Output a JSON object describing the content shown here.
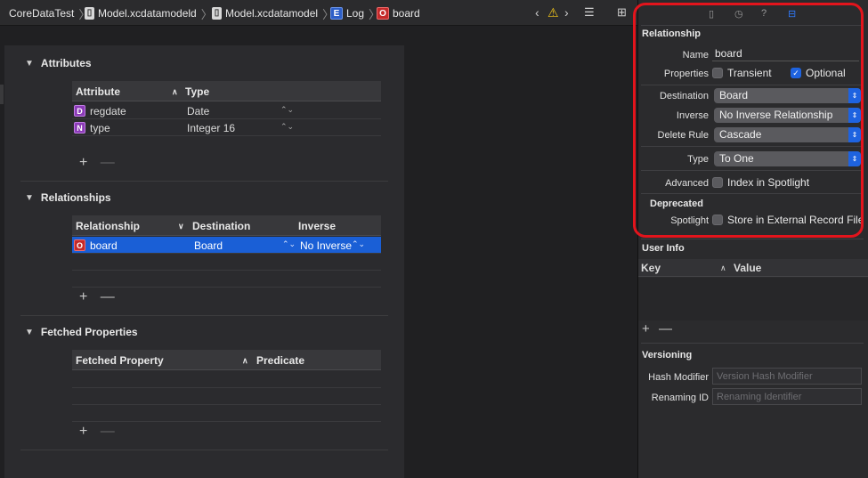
{
  "breadcrumb": {
    "items": [
      {
        "label": "CoreDataTest",
        "icon": "folder-icon"
      },
      {
        "label": "Model.xcdatamodeld",
        "icon": "file-icon"
      },
      {
        "label": "Model.xcdatamodel",
        "icon": "file-icon"
      },
      {
        "label": "Log",
        "icon": "E"
      },
      {
        "label": "board",
        "icon": "O"
      }
    ]
  },
  "editor": {
    "attributes": {
      "title": "Attributes",
      "columns": [
        "Attribute",
        "Type"
      ],
      "rows": [
        {
          "icon": "D",
          "name": "regdate",
          "type": "Date"
        },
        {
          "icon": "N",
          "name": "type",
          "type": "Integer 16"
        }
      ]
    },
    "relationships": {
      "title": "Relationships",
      "columns": [
        "Relationship",
        "Destination",
        "Inverse"
      ],
      "rows": [
        {
          "icon": "O",
          "name": "board",
          "destination": "Board",
          "inverse": "No Inverse"
        }
      ]
    },
    "fetched": {
      "title": "Fetched Properties",
      "columns": [
        "Fetched Property",
        "Predicate"
      ]
    },
    "plus": "+",
    "minus": "—"
  },
  "inspector": {
    "relationship": {
      "title": "Relationship",
      "name_label": "Name",
      "name_value": "board",
      "properties_label": "Properties",
      "transient_label": "Transient",
      "transient_checked": false,
      "optional_label": "Optional",
      "optional_checked": true,
      "destination_label": "Destination",
      "destination_value": "Board",
      "inverse_label": "Inverse",
      "inverse_value": "No Inverse Relationship",
      "delete_rule_label": "Delete Rule",
      "delete_rule_value": "Cascade",
      "type_label": "Type",
      "type_value": "To One",
      "advanced_label": "Advanced",
      "index_label": "Index in Spotlight",
      "deprecated_title": "Deprecated",
      "spotlight_label": "Spotlight",
      "external_label": "Store in External Record File"
    },
    "user_info": {
      "title": "User Info",
      "key_col": "Key",
      "value_col": "Value"
    },
    "versioning": {
      "title": "Versioning",
      "hash_label": "Hash Modifier",
      "hash_placeholder": "Version Hash Modifier",
      "renaming_label": "Renaming ID",
      "renaming_placeholder": "Renaming Identifier"
    }
  },
  "colors": {
    "accent": "#1e63e0",
    "highlight": "#e3141c"
  }
}
